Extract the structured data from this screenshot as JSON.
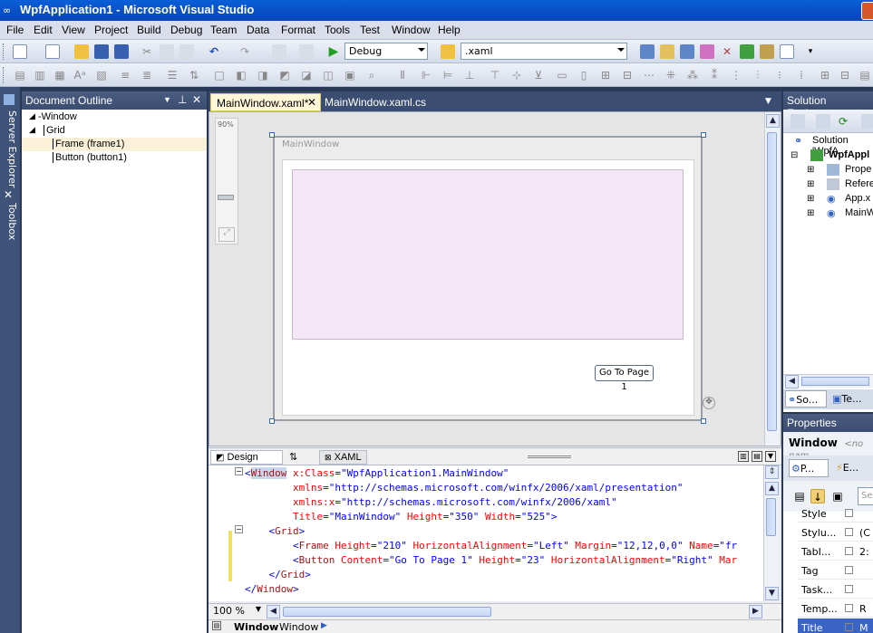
{
  "window": {
    "title": "WpfApplication1 - Microsoft Visual Studio"
  },
  "menu": [
    "File",
    "Edit",
    "View",
    "Project",
    "Build",
    "Debug",
    "Team",
    "Data",
    "Format",
    "Tools",
    "Test",
    "Window",
    "Help"
  ],
  "toolbar": {
    "config_value": "Debug",
    "find_value": ".xaml"
  },
  "left_tabs": [
    "Server Explorer",
    "Toolbox"
  ],
  "document_outline": {
    "title": "Document Outline",
    "items": [
      {
        "label": "-Window"
      },
      {
        "label": "Grid"
      },
      {
        "label": "Frame (frame1)"
      },
      {
        "label": "Button (button1)"
      }
    ]
  },
  "tabs": [
    {
      "label": "MainWindow.xaml*",
      "active": true
    },
    {
      "label": "MainWindow.xaml.cs",
      "active": false
    }
  ],
  "designer": {
    "zoom_label": "90%",
    "window_title": "MainWindow",
    "button_text": "Go To Page 1"
  },
  "split": {
    "design_label": "Design",
    "xaml_label": "XAML"
  },
  "xaml": {
    "lines": [
      {
        "parts": [
          [
            "sym",
            "<"
          ],
          [
            "tag",
            "Window"
          ],
          [
            "sp",
            " "
          ],
          [
            "attr",
            "x:Class"
          ],
          [
            "sym",
            "=\""
          ],
          [
            "val",
            "WpfApplication1.MainWindow"
          ],
          [
            "sym",
            "\""
          ]
        ]
      },
      {
        "parts": [
          [
            "sp",
            "        "
          ],
          [
            "attr",
            "xmlns"
          ],
          [
            "sym",
            "=\""
          ],
          [
            "val",
            "http://schemas.microsoft.com/winfx/2006/xaml/presentation"
          ],
          [
            "sym",
            "\""
          ]
        ]
      },
      {
        "parts": [
          [
            "sp",
            "        "
          ],
          [
            "attr",
            "xmlns:x"
          ],
          [
            "sym",
            "=\""
          ],
          [
            "val",
            "http://schemas.microsoft.com/winfx/2006/xaml"
          ],
          [
            "sym",
            "\""
          ]
        ]
      },
      {
        "parts": [
          [
            "sp",
            "        "
          ],
          [
            "attr",
            "Title"
          ],
          [
            "sym",
            "=\""
          ],
          [
            "val",
            "MainWindow"
          ],
          [
            "sym",
            "\" "
          ],
          [
            "attr",
            "Height"
          ],
          [
            "sym",
            "=\""
          ],
          [
            "val",
            "350"
          ],
          [
            "sym",
            "\" "
          ],
          [
            "attr",
            "Width"
          ],
          [
            "sym",
            "=\""
          ],
          [
            "val",
            "525"
          ],
          [
            "sym",
            "\">"
          ]
        ]
      },
      {
        "parts": [
          [
            "sp",
            "    "
          ],
          [
            "sym",
            "<"
          ],
          [
            "tag",
            "Grid"
          ],
          [
            "sym",
            ">"
          ]
        ]
      },
      {
        "parts": [
          [
            "sp",
            "        "
          ],
          [
            "sym",
            "<"
          ],
          [
            "tag",
            "Frame"
          ],
          [
            "sp",
            " "
          ],
          [
            "attr",
            "Height"
          ],
          [
            "sym",
            "=\""
          ],
          [
            "val",
            "210"
          ],
          [
            "sym",
            "\" "
          ],
          [
            "attr",
            "HorizontalAlignment"
          ],
          [
            "sym",
            "=\""
          ],
          [
            "val",
            "Left"
          ],
          [
            "sym",
            "\" "
          ],
          [
            "attr",
            "Margin"
          ],
          [
            "sym",
            "=\""
          ],
          [
            "val",
            "12,12,0,0"
          ],
          [
            "sym",
            "\" "
          ],
          [
            "attr",
            "Name"
          ],
          [
            "sym",
            "=\""
          ],
          [
            "val",
            "fr"
          ]
        ]
      },
      {
        "parts": [
          [
            "sp",
            "        "
          ],
          [
            "sym",
            "<"
          ],
          [
            "tag",
            "Button"
          ],
          [
            "sp",
            " "
          ],
          [
            "attr",
            "Content"
          ],
          [
            "sym",
            "=\""
          ],
          [
            "val",
            "Go To Page 1"
          ],
          [
            "sym",
            "\" "
          ],
          [
            "attr",
            "Height"
          ],
          [
            "sym",
            "=\""
          ],
          [
            "val",
            "23"
          ],
          [
            "sym",
            "\" "
          ],
          [
            "attr",
            "HorizontalAlignment"
          ],
          [
            "sym",
            "=\""
          ],
          [
            "val",
            "Right"
          ],
          [
            "sym",
            "\" "
          ],
          [
            "attr",
            "Mar"
          ]
        ]
      },
      {
        "parts": [
          [
            "sp",
            "    "
          ],
          [
            "sym",
            "</"
          ],
          [
            "tag",
            "Grid"
          ],
          [
            "sym",
            ">"
          ]
        ]
      },
      {
        "parts": [
          [
            "sym",
            "</"
          ],
          [
            "tag",
            "Window"
          ],
          [
            "sym",
            ">"
          ]
        ]
      }
    ]
  },
  "editor_status": {
    "zoom": "100 %"
  },
  "breadcrumb": {
    "item1": "Window",
    "item2": "Window"
  },
  "solution_explorer": {
    "title": "Solution Explorer",
    "items": [
      "Solution 'WpfA",
      "WpfAppl",
      "Prope",
      "Refere",
      "App.x",
      "MainW"
    ],
    "tab1": "So...",
    "tab2": "Te..."
  },
  "properties": {
    "title": "Properties",
    "object_type": "Window",
    "object_name": "<no nam",
    "tab1": "P...",
    "tab2": "E...",
    "search_placeholder": "Se",
    "rows": [
      {
        "name": "Style",
        "value": ""
      },
      {
        "name": "Stylu...",
        "value": "(C"
      },
      {
        "name": "TabI...",
        "value": "2:"
      },
      {
        "name": "Tag",
        "value": ""
      },
      {
        "name": "Task...",
        "value": ""
      },
      {
        "name": "Temp...",
        "value": "R"
      },
      {
        "name": "Title",
        "value": "M"
      }
    ]
  }
}
